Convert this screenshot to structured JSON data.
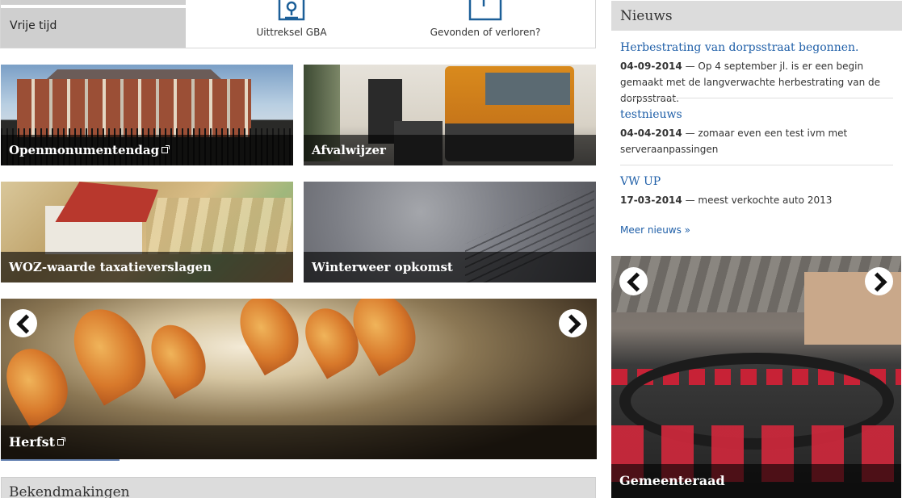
{
  "top": {
    "menu_item": "Vrije tijd",
    "quick_links": [
      {
        "label": "Uittreksel GBA",
        "icon": "document-stamp-icon"
      },
      {
        "label": "Gevonden of verloren?",
        "icon": "clipboard-icon"
      }
    ]
  },
  "tiles": [
    {
      "label": "Openmonumentendag",
      "external": true
    },
    {
      "label": "Afvalwijzer"
    },
    {
      "label": "WOZ-waarde taxatieverslagen"
    },
    {
      "label": "Winterweer opkomst"
    }
  ],
  "carousel_main": {
    "caption": "Herfst",
    "external": true
  },
  "bekendmakingen": {
    "title": "Bekendmakingen"
  },
  "news": {
    "title": "Nieuws",
    "items": [
      {
        "title": "Herbestrating van dorpsstraat begonnen.",
        "date": "04-09-2014",
        "summary": "— Op 4 september jl. is er een begin gemaakt met de langverwachte herbestrating van de dorpsstraat."
      },
      {
        "title": "testnieuws",
        "date": "04-04-2014",
        "summary": "— zomaar even een test ivm met serveraanpassingen"
      },
      {
        "title": "VW UP",
        "date": "17-03-2014",
        "summary": "— meest verkochte auto 2013"
      }
    ],
    "more": "Meer nieuws »"
  },
  "carousel_side": {
    "caption": "Gemeenteraad"
  },
  "colors": {
    "link": "#1f5fa8",
    "panel_header": "#dcdcdc",
    "menu_bg": "#cfcfcf",
    "icon": "#1c5f98"
  }
}
